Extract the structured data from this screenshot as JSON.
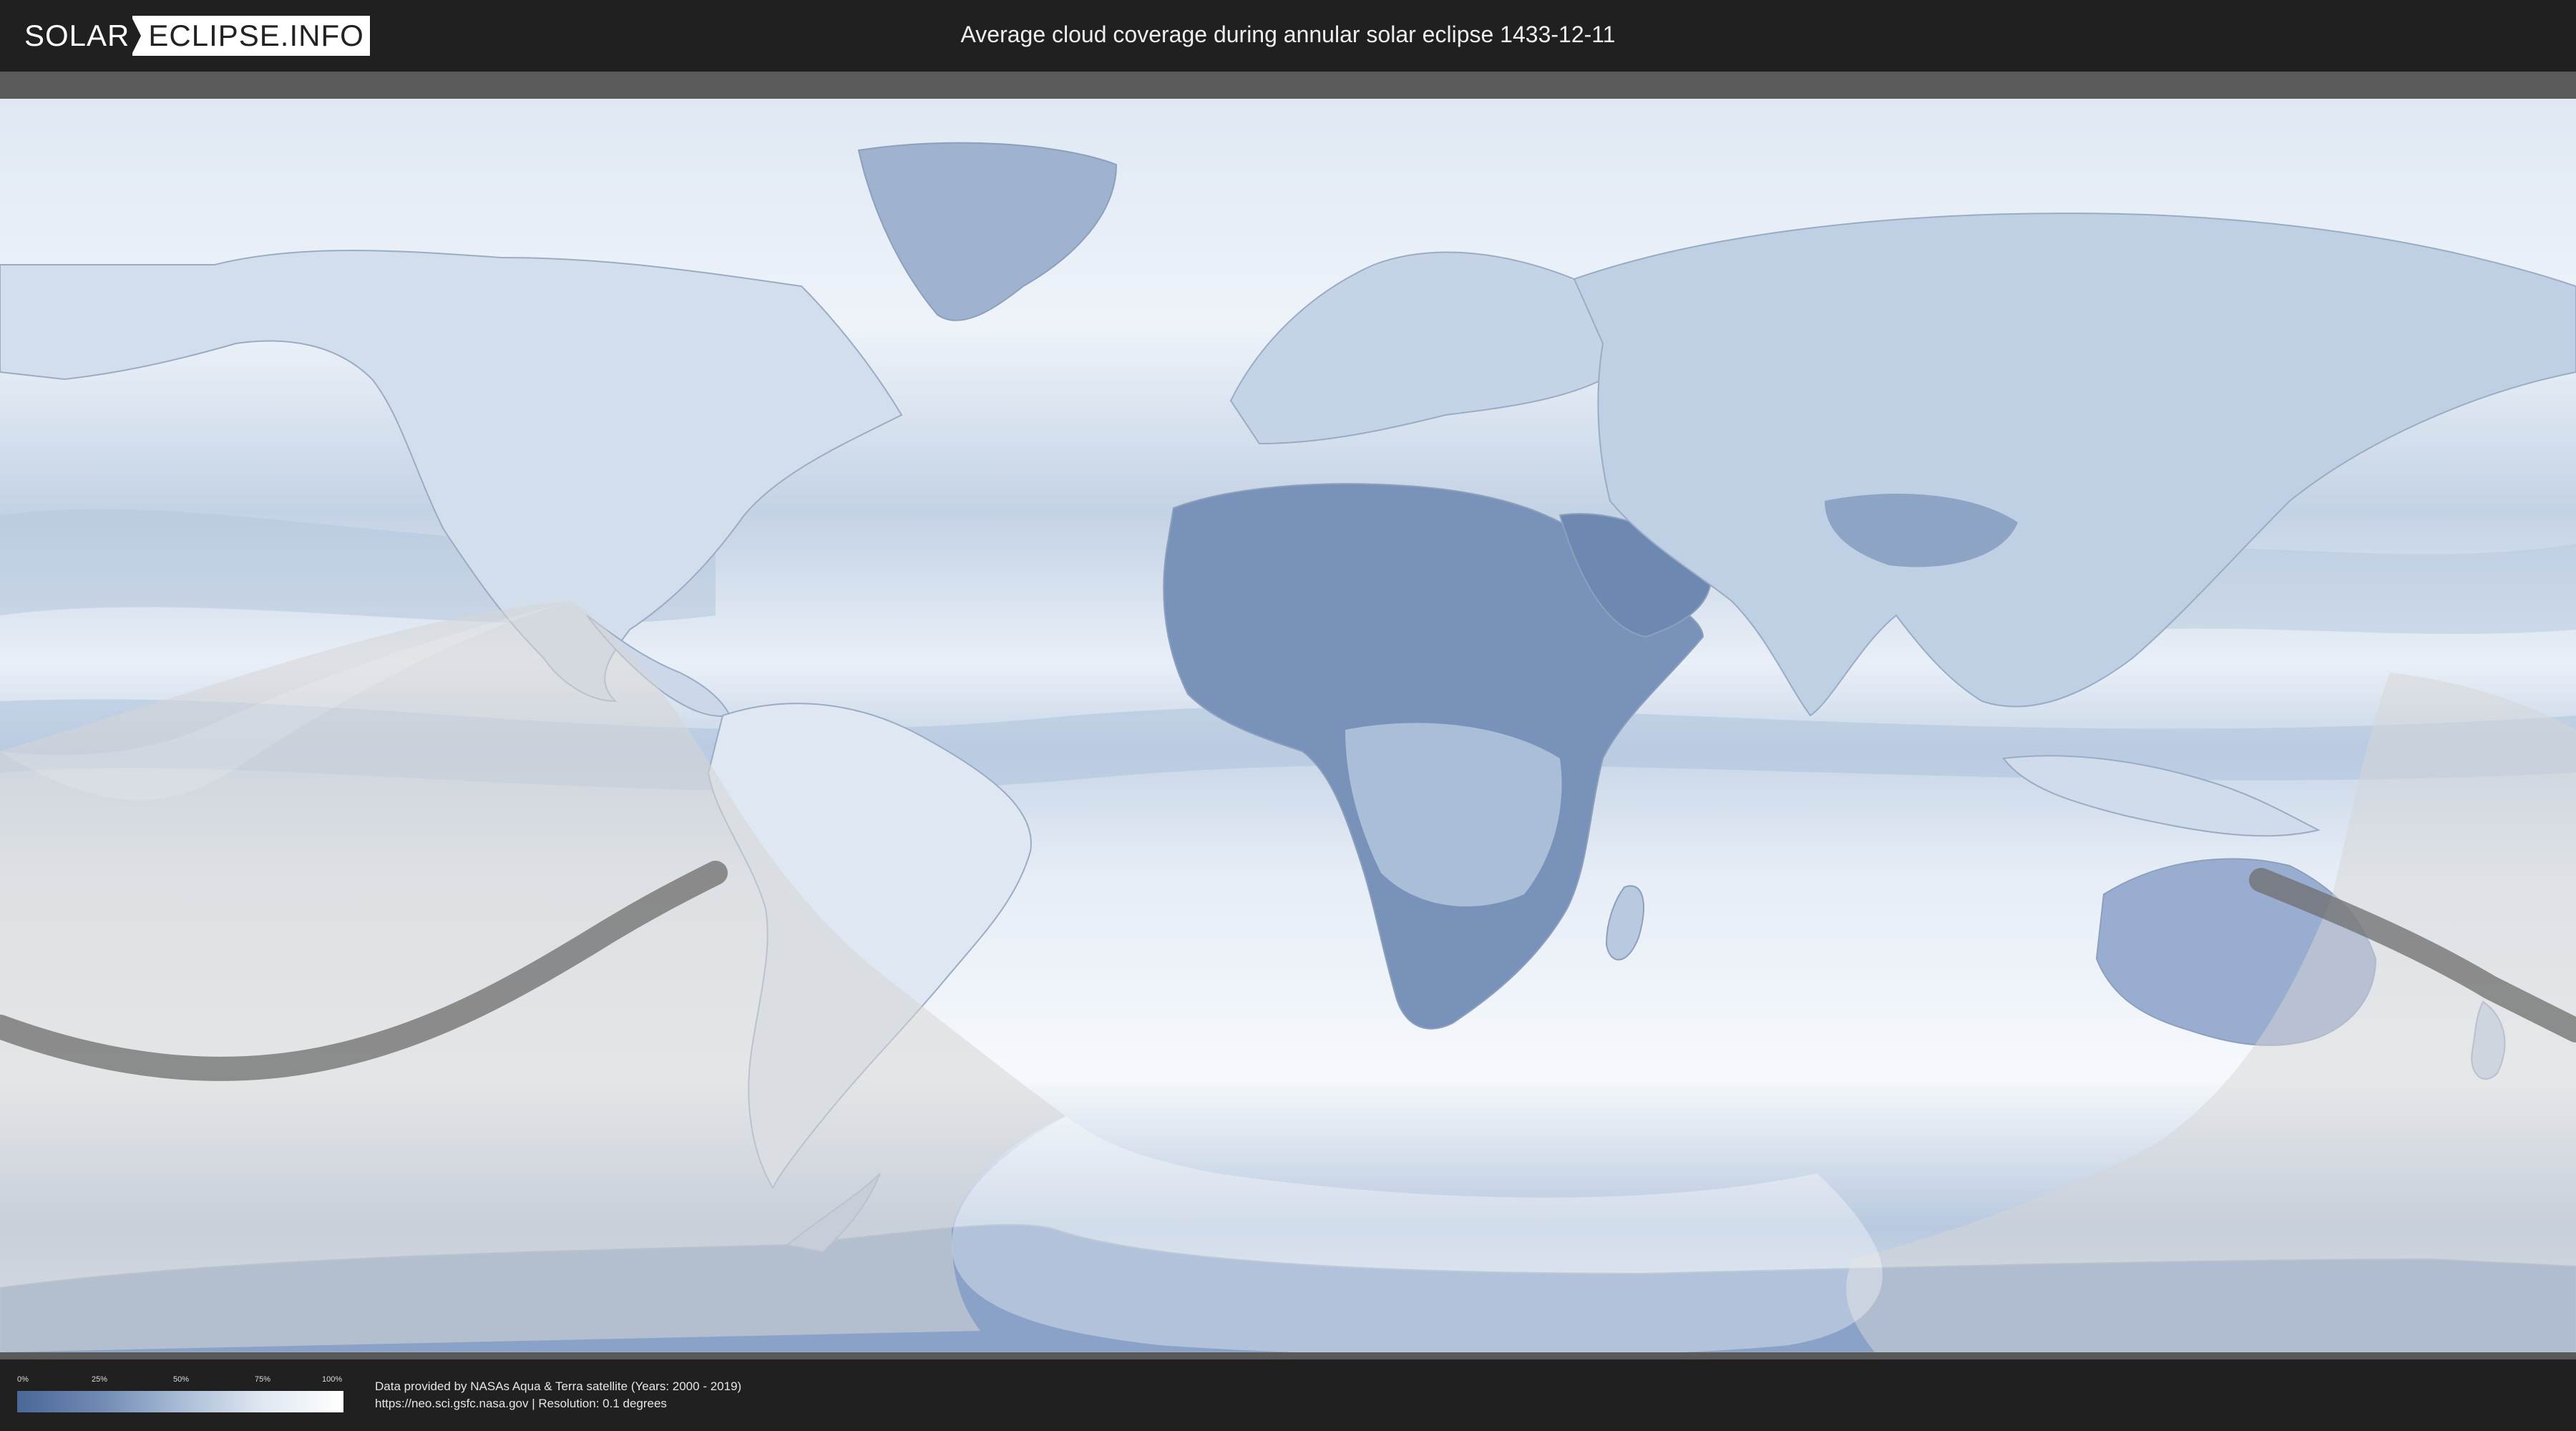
{
  "header": {
    "logo_left": "SOLAR",
    "logo_right": "ECLIPSE.INFO",
    "title": "Average cloud coverage during annular solar eclipse 1433-12-11"
  },
  "legend": {
    "ticks": [
      "0%",
      "25%",
      "50%",
      "75%",
      "100%"
    ],
    "color_low": "#4a6797",
    "color_high": "#ffffff"
  },
  "source": {
    "line1": "Data provided by NASAs Aqua & Terra satellite (Years: 2000 - 2019)",
    "line2": "https://neo.sci.gsfc.nasa.gov | Resolution: 0.1 degrees"
  },
  "colors": {
    "header_bg": "#202020",
    "cloud_clear": "#4f6f9f",
    "cloud_full": "#ffffff",
    "eclipse_path": "#6e6e6e",
    "penumbra_shade": "#d8d8d8"
  }
}
